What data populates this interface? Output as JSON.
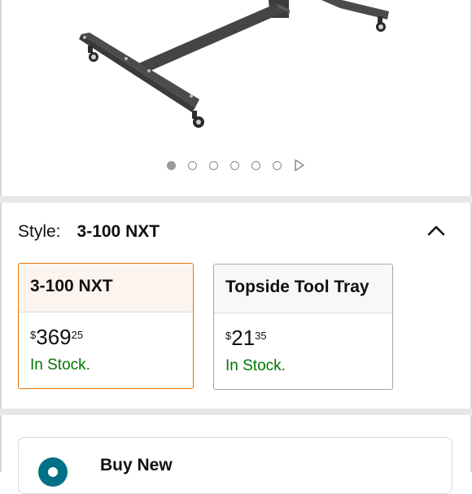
{
  "carousel": {
    "total_dots": 6,
    "active_index": 0,
    "has_video": true
  },
  "style_selector": {
    "label": "Style:",
    "selected_value": "3-100 NXT",
    "expanded": true
  },
  "options": [
    {
      "name": "3-100 NXT",
      "price_symbol": "$",
      "price_whole": "369",
      "price_fraction": "25",
      "stock": "In Stock.",
      "selected": true
    },
    {
      "name": "Topside Tool Tray",
      "price_symbol": "$",
      "price_whole": "21",
      "price_fraction": "35",
      "stock": "In Stock.",
      "selected": false
    }
  ],
  "buy_box": {
    "label": "Buy New"
  },
  "colors": {
    "selected_border": "#e77600",
    "stock_green": "#007600",
    "radio_teal": "#007185",
    "separator": "#e7e7e7"
  },
  "icons": [
    "chevron-up-icon",
    "play-icon",
    "radio-selected-icon"
  ]
}
